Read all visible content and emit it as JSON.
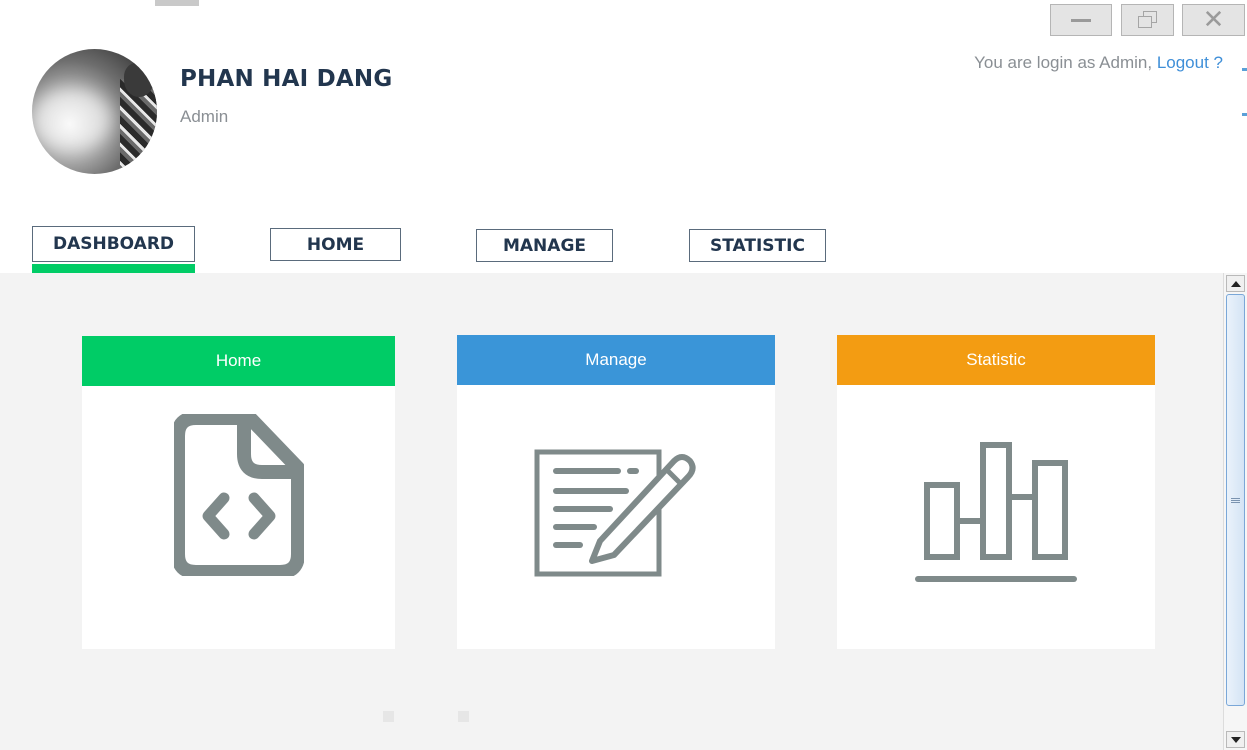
{
  "window": {
    "minimize_label": "minimize",
    "maximize_label": "restore",
    "close_label": "close"
  },
  "profile": {
    "name": "PHAN HAI DANG",
    "role": "Admin"
  },
  "session": {
    "prefix": "You are login as Admin, ",
    "logout_label": "Logout ?"
  },
  "tabs": [
    {
      "label": "DASHBOARD",
      "active": true
    },
    {
      "label": "HOME"
    },
    {
      "label": "MANAGE"
    },
    {
      "label": "STATISTIC"
    }
  ],
  "cards": [
    {
      "title": "Home",
      "color": "#00cc66",
      "icon": "code-file-icon"
    },
    {
      "title": "Manage",
      "color": "#3a95d8",
      "icon": "edit-document-icon"
    },
    {
      "title": "Statistic",
      "color": "#f39c12",
      "icon": "bar-chart-icon"
    }
  ],
  "colors": {
    "icon_gray": "#7f8a8a",
    "indicator": "#00cc66",
    "text_dark": "#22364e",
    "link": "#3f8fd8"
  }
}
